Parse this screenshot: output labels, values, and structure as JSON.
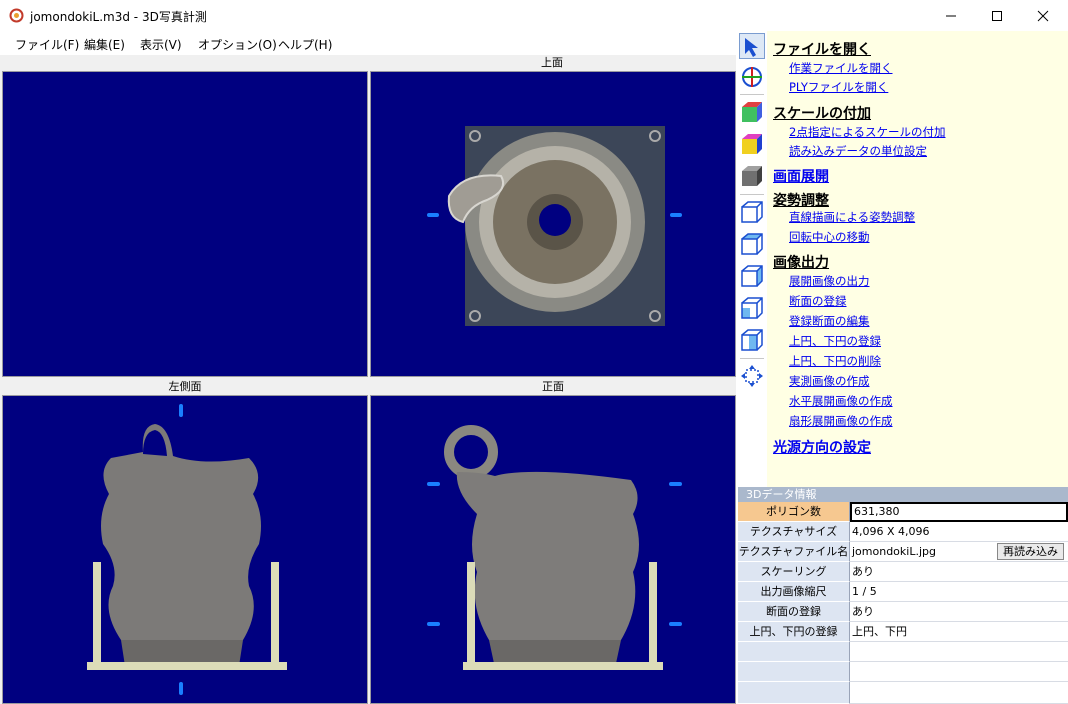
{
  "window": {
    "title": "jomondokiL.m3d - 3D写真計測",
    "minimize_glyph": "minimize-icon",
    "maximize_glyph": "maximize-icon",
    "close_glyph": "close-icon"
  },
  "menu": [
    "ファイル(F)",
    "編集(E)",
    "表示(V)",
    "オプション(O)",
    "ヘルプ(H)"
  ],
  "views": {
    "top": "上面",
    "left_side": "左側面",
    "front": "正面"
  },
  "toolbar_icons": [
    "select-arrow-icon",
    "crosshair-icon",
    "color-cube-icon",
    "face-cube-icon",
    "gray-cube-icon",
    "wire-cube-icon",
    "wire-cube-icon",
    "wire-cube-icon",
    "wire-cube-icon",
    "wire-cube-icon",
    "move-cross-icon"
  ],
  "panel": {
    "open_file": "ファイルを開く",
    "open_work_file": "作業ファイルを開く",
    "open_ply_file": "PLYファイルを開く",
    "add_scale": "スケールの付加",
    "two_point_scale": "2点指定によるスケールの付加",
    "unit_setting": "読み込みデータの単位設定",
    "screen_unfold": "画面展開",
    "posture_adjust": "姿勢調整",
    "line_posture": "直線描画による姿勢調整",
    "move_center": "回転中心の移動",
    "image_output": "画像出力",
    "unfold_image_output": "展開画像の出力",
    "register_section": "断面の登録",
    "edit_sections": "登録断面の編集",
    "register_circles": "上円、下円の登録",
    "delete_circles": "上円、下円の削除",
    "create_measured": "実測画像の作成",
    "create_horizontal": "水平展開画像の作成",
    "create_fan": "扇形展開画像の作成",
    "light_direction": "光源方向の設定"
  },
  "info": {
    "header": "3Dデータ情報",
    "rows": [
      {
        "label": "ポリゴン数",
        "value": "631,380"
      },
      {
        "label": "テクスチャサイズ",
        "value": "4,096 X 4,096"
      },
      {
        "label": "テクスチャファイル名",
        "value": "jomondokiL.jpg"
      },
      {
        "label": "スケーリング",
        "value": "あり"
      },
      {
        "label": "出力画像縮尺",
        "value": "1 / 5"
      },
      {
        "label": "断面の登録",
        "value": "あり"
      },
      {
        "label": "上円、下円の登録",
        "value": "上円、下円"
      }
    ],
    "reload_button": "再読み込み"
  },
  "colors": {
    "viewport_bg": "#000080",
    "link": "#0000ee",
    "panel_bg": "#ffffe4",
    "marker": "#1a7fff"
  }
}
